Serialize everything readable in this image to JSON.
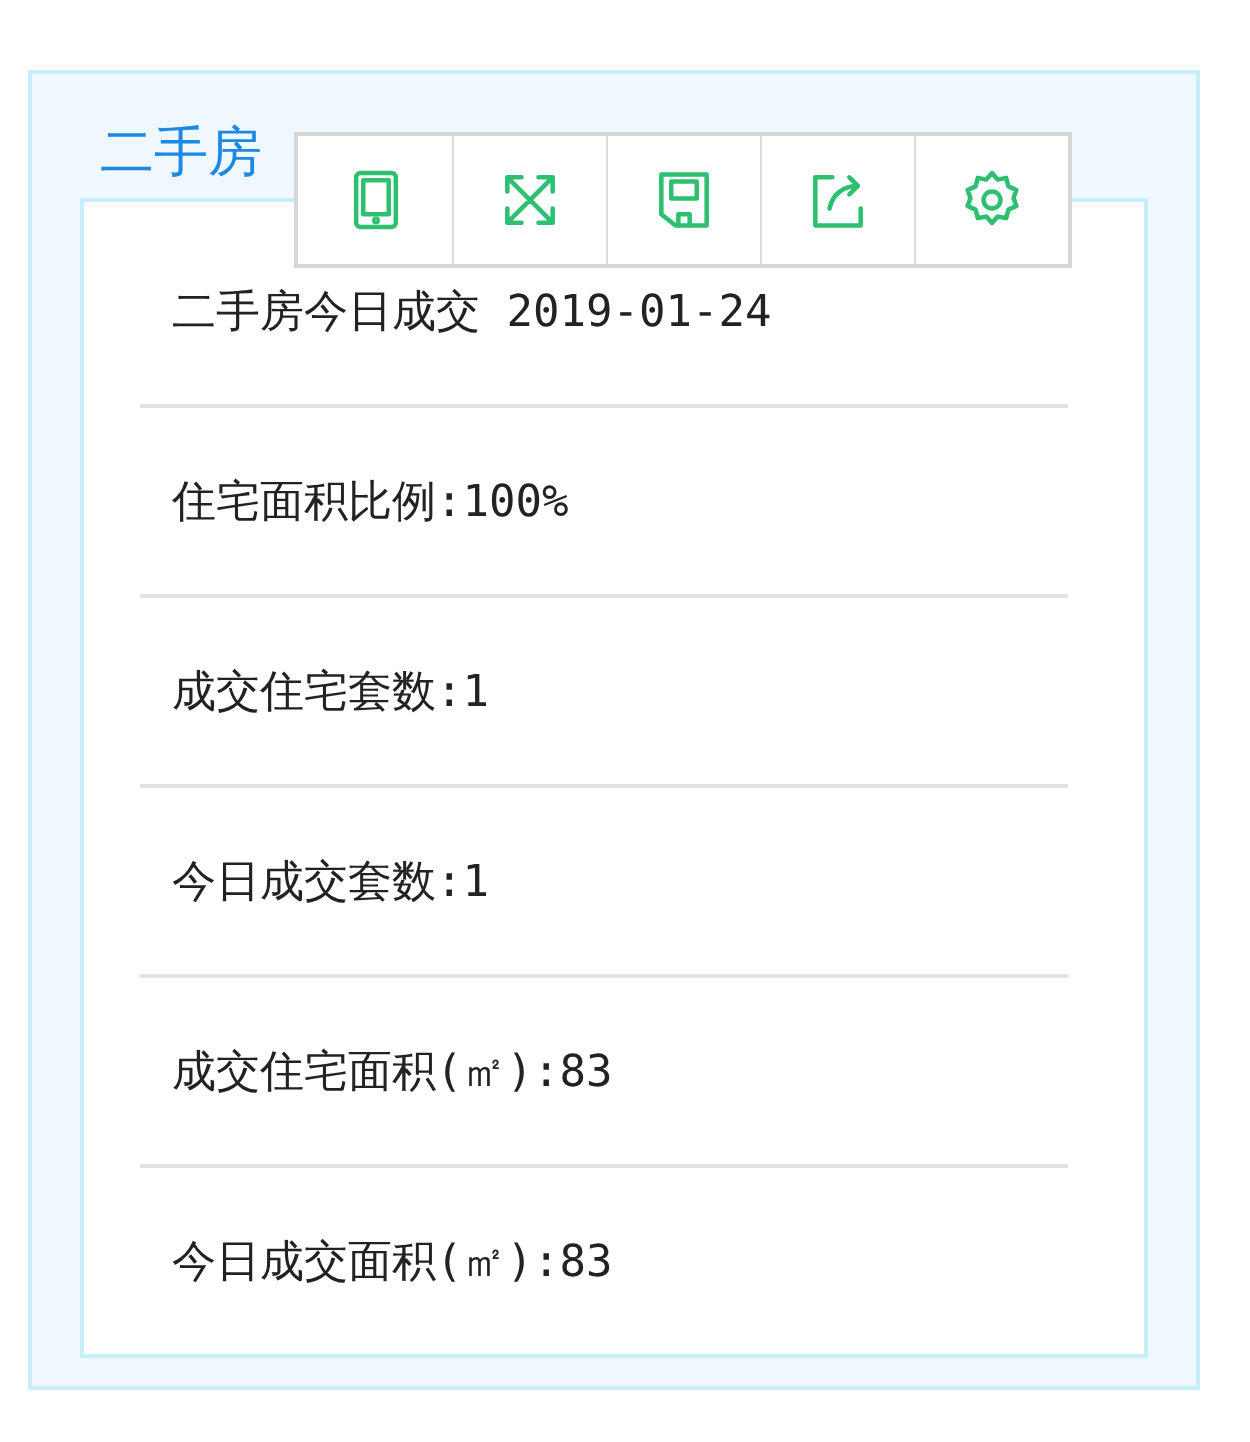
{
  "panel": {
    "title": "二手房"
  },
  "toolbar": [
    {
      "kind": "tablet"
    },
    {
      "kind": "expand"
    },
    {
      "kind": "save"
    },
    {
      "kind": "share"
    },
    {
      "kind": "settings"
    }
  ],
  "rows": [
    "二手房今日成交 2019-01-24",
    "住宅面积比例:100%",
    "成交住宅套数:1",
    "今日成交套数:1",
    "成交住宅面积(㎡):83",
    "今日成交面积(㎡):83"
  ]
}
